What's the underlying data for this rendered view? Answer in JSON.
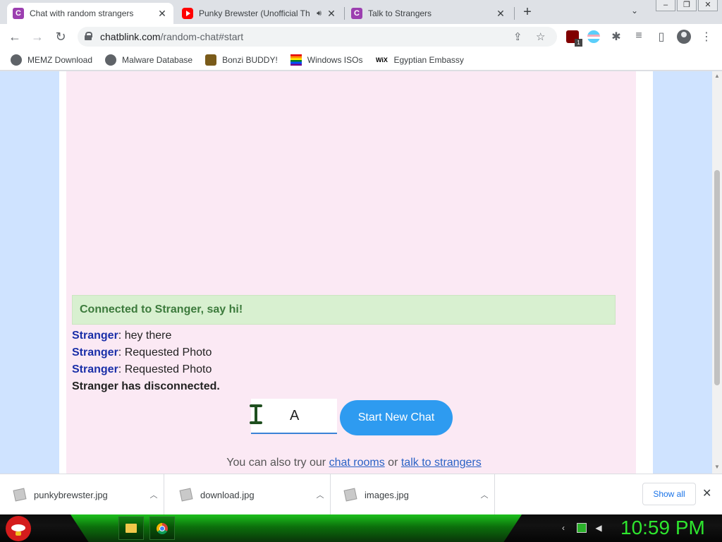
{
  "tabs": [
    {
      "title": "Chat with random strangers",
      "favicon": "chatblink-c-icon",
      "active": true
    },
    {
      "title": "Punky Brewster (Unofficial Th",
      "favicon": "youtube-icon",
      "active": false,
      "audio": "speaker-icon"
    },
    {
      "title": "Talk to Strangers",
      "favicon": "chatblink-c-icon",
      "active": false
    }
  ],
  "toolbar": {
    "url_host": "chatblink.com",
    "url_path": "/random-chat#start",
    "ublock_badge": "1"
  },
  "bookmarks": [
    {
      "label": "MEMZ Download",
      "icon": "globe-icon"
    },
    {
      "label": "Malware Database",
      "icon": "globe-icon"
    },
    {
      "label": "Bonzi BUDDY!",
      "icon": "bonzi-icon"
    },
    {
      "label": "Windows ISOs",
      "icon": "rainbow-flag-icon"
    },
    {
      "label": "Egyptian Embassy",
      "icon": "wix-icon"
    }
  ],
  "wix_text": "WiX",
  "chat": {
    "status": "Connected to Stranger, say hi!",
    "messages": [
      {
        "nick": "Stranger",
        "text": ": hey there"
      },
      {
        "nick": "Stranger",
        "text": ": Requested Photo"
      },
      {
        "nick": "Stranger",
        "text": ": Requested Photo"
      }
    ],
    "disconnect": "Stranger has disconnected.",
    "input_value": "A",
    "start_label": "Start New Chat",
    "also_try": "You can also try our",
    "chat_rooms": "chat rooms",
    "or": "or",
    "talk_to_strangers": "talk to strangers"
  },
  "downloads": [
    {
      "name": "punkybrewster.jpg"
    },
    {
      "name": "download.jpg"
    },
    {
      "name": "images.jpg"
    }
  ],
  "show_all": "Show all",
  "clock": "10:59 PM",
  "colors": {
    "chat_bg": "#fbe9f4",
    "page_bg": "#cfe3ff",
    "status_bg": "#d8f0d0",
    "status_text": "#3c7a3c",
    "nick": "#1a2fa8",
    "button": "#2e9bf0",
    "clock": "#2ee62e"
  }
}
